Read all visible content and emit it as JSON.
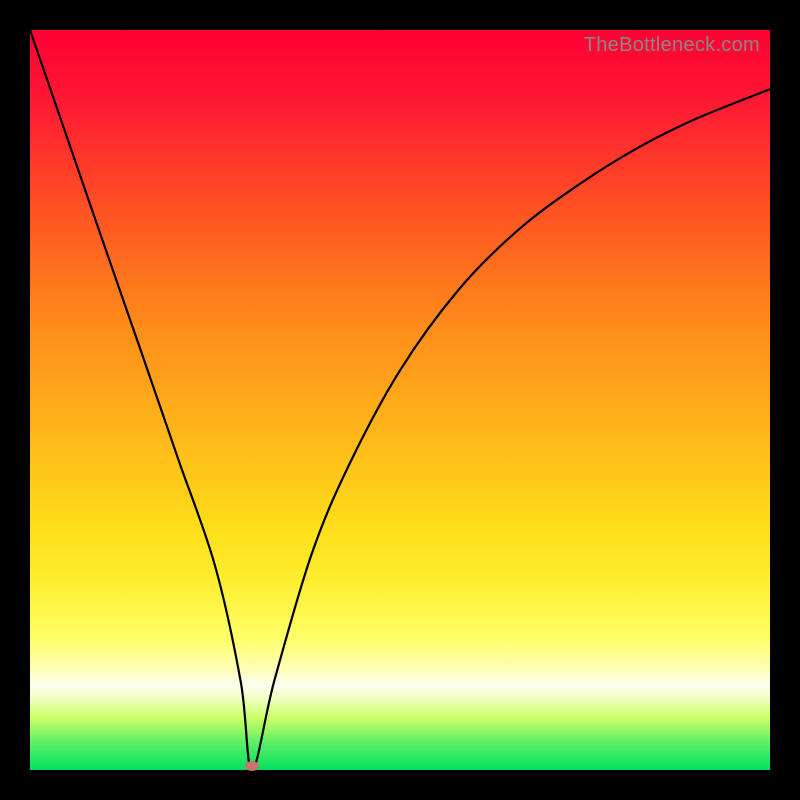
{
  "watermark": "TheBottleneck.com",
  "chart_data": {
    "type": "line",
    "title": "",
    "xlabel": "",
    "ylabel": "",
    "xlim": [
      0,
      1
    ],
    "ylim": [
      0,
      1
    ],
    "series": [
      {
        "name": "curve",
        "x": [
          0.0,
          0.05,
          0.1,
          0.15,
          0.2,
          0.25,
          0.285,
          0.3,
          0.33,
          0.38,
          0.43,
          0.5,
          0.58,
          0.66,
          0.74,
          0.82,
          0.9,
          1.0
        ],
        "values": [
          1.0,
          0.855,
          0.71,
          0.566,
          0.421,
          0.276,
          0.118,
          0.0,
          0.12,
          0.29,
          0.41,
          0.54,
          0.65,
          0.73,
          0.79,
          0.84,
          0.88,
          0.92
        ]
      }
    ],
    "annotations": [
      {
        "name": "minimum-marker",
        "x": 0.3,
        "y": 0.005
      }
    ],
    "background_gradient_stops": [
      {
        "pos": 0.0,
        "color": "#ff0033"
      },
      {
        "pos": 0.4,
        "color": "#ff8c1a"
      },
      {
        "pos": 0.75,
        "color": "#ffef33"
      },
      {
        "pos": 0.89,
        "color": "#fffff0"
      },
      {
        "pos": 1.0,
        "color": "#00e060"
      }
    ]
  }
}
